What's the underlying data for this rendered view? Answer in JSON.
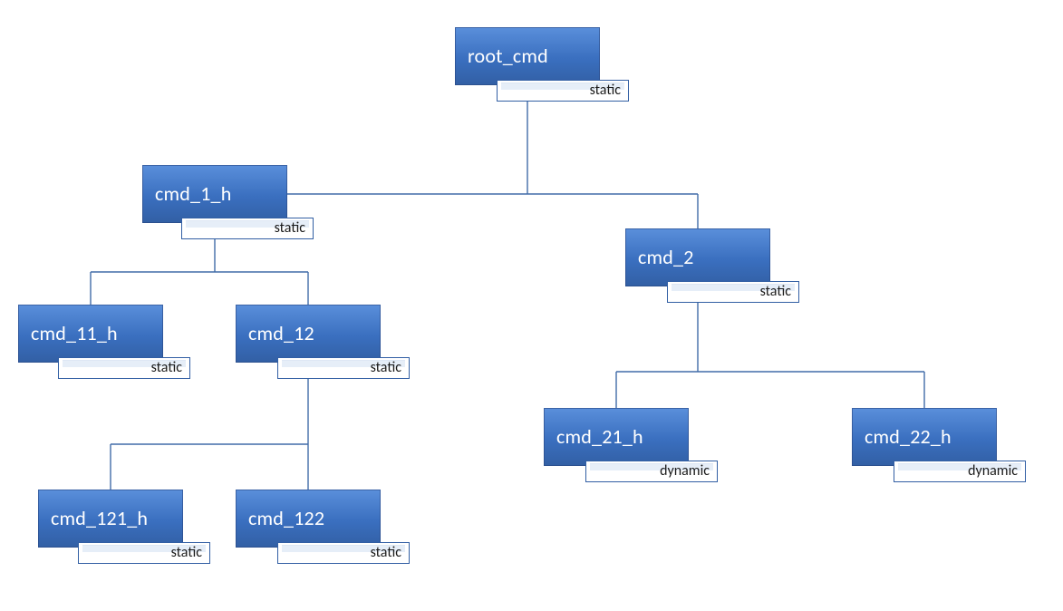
{
  "diagram": {
    "kind": "command-tree",
    "root": {
      "name": "root_cmd",
      "tag": "static",
      "children": [
        {
          "name": "cmd_1_h",
          "tag": "static",
          "children": [
            {
              "name": "cmd_11_h",
              "tag": "static",
              "children": []
            },
            {
              "name": "cmd_12",
              "tag": "static",
              "children": [
                {
                  "name": "cmd_121_h",
                  "tag": "static",
                  "children": []
                },
                {
                  "name": "cmd_122",
                  "tag": "static",
                  "children": []
                }
              ]
            }
          ]
        },
        {
          "name": "cmd_2",
          "tag": "static",
          "children": [
            {
              "name": "cmd_21_h",
              "tag": "dynamic",
              "children": []
            },
            {
              "name": "cmd_22_h",
              "tag": "dynamic",
              "children": []
            }
          ]
        }
      ]
    }
  },
  "labels": {
    "root_cmd": "root_cmd",
    "cmd_1_h": "cmd_1_h",
    "cmd_2": "cmd_2",
    "cmd_11_h": "cmd_11_h",
    "cmd_12": "cmd_12",
    "cmd_121_h": "cmd_121_h",
    "cmd_122": "cmd_122",
    "cmd_21_h": "cmd_21_h",
    "cmd_22_h": "cmd_22_h"
  },
  "tags": {
    "root_cmd": "static",
    "cmd_1_h": "static",
    "cmd_2": "static",
    "cmd_11_h": "static",
    "cmd_12": "static",
    "cmd_121_h": "static",
    "cmd_122": "static",
    "cmd_21_h": "dynamic",
    "cmd_22_h": "dynamic"
  },
  "colors": {
    "node_top": "#5A8FDB",
    "node_bottom": "#325FA4",
    "connector": "#416CA8",
    "tag_bg": "#FFFFFF",
    "tag_inner": "#E6EEF8"
  }
}
